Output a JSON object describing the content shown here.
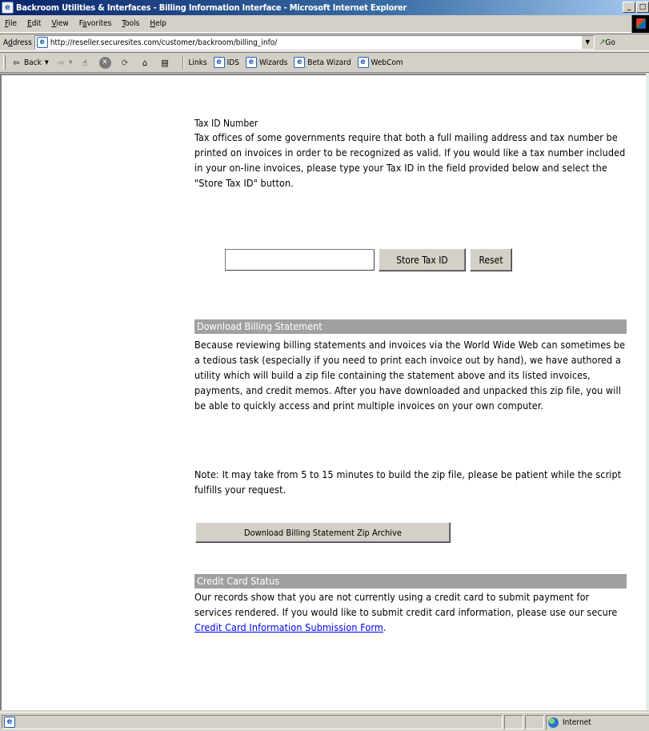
{
  "window": {
    "title": "Backroom Utilities & Interfaces - Billing Information Interface - Microsoft Internet Explorer"
  },
  "menu": {
    "items": [
      {
        "key": "F",
        "rest": "ile"
      },
      {
        "key": "E",
        "rest": "dit"
      },
      {
        "key": "V",
        "rest": "iew"
      },
      {
        "key": "a",
        "pre": "F",
        "rest": "vorites"
      },
      {
        "key": "T",
        "rest": "ools"
      },
      {
        "key": "H",
        "rest": "elp"
      }
    ]
  },
  "address": {
    "label_key": "d",
    "label_pre": "A",
    "label_rest": "dress",
    "url": "http://reseller.securesites.com/customer/backroom/billing_info/",
    "go": "Go"
  },
  "toolbar": {
    "back": "Back",
    "links_label": "Links",
    "links": [
      "IDS",
      "Wizards",
      "Beta Wizard",
      "WebCom"
    ]
  },
  "tax": {
    "title": "Tax ID Number",
    "description": "Tax offices of some governments require that both a full mailing address and tax number be printed on invoices in order to be recognized as valid. If you would like a tax number included in your on-line invoices, please type your Tax ID in the field provided below and select the \"Store Tax ID\" button.",
    "input_value": "",
    "store_button": "Store Tax ID",
    "reset_button": "Reset"
  },
  "download": {
    "heading": "Download Billing Statement",
    "description": "Because reviewing billing statements and invoices via the World Wide Web can sometimes be a tedious task (especially if you need to print each invoice out by hand), we have authored a utility which will build a zip file containing the statement above and its listed invoices, payments, and credit memos. After you have downloaded and unpacked this zip file, you will be able to quickly access and print multiple invoices on your own computer.",
    "note": "Note: It may take from 5 to 15 minutes to build the zip file, please be patient while the script fulfills your request.",
    "button": "Download Billing Statement Zip Archive"
  },
  "credit": {
    "heading": "Credit Card Status",
    "text_before": "Our records show that you are not currently using a credit card to submit payment for services rendered. If you would like to submit credit card information, please use our secure ",
    "link": "Credit Card Information Submission Form",
    "text_after": "."
  },
  "status": {
    "zone": "Internet"
  }
}
